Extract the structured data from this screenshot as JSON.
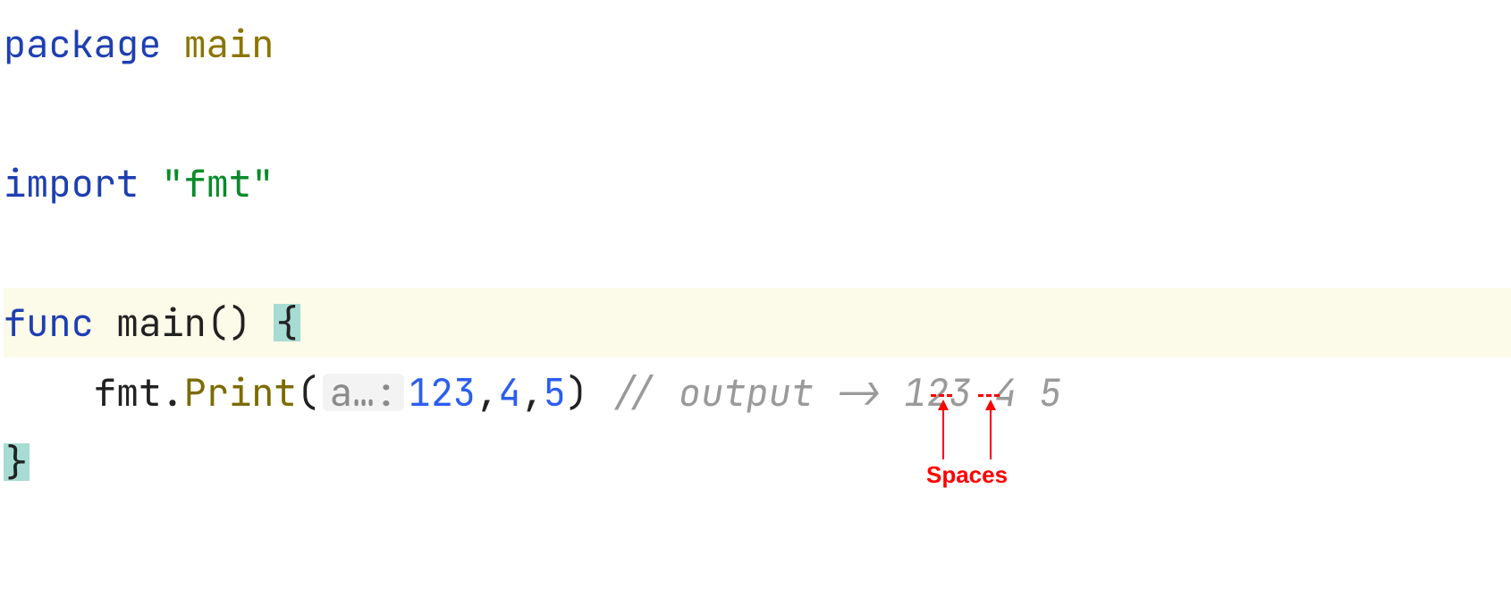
{
  "code": {
    "line1": {
      "keyword": "package",
      "name": "main"
    },
    "line3": {
      "keyword": "import",
      "pkg": "\"fmt\""
    },
    "line5": {
      "keyword": "func",
      "name": "main",
      "parens": "()",
      "brace": "{"
    },
    "line6": {
      "indent": "    ",
      "receiver": "fmt",
      "dot": ".",
      "call": "Print",
      "open": "(",
      "hint": "a…:",
      "arg1": "123",
      "comma1": ",",
      "arg2": "4",
      "comma2": ",",
      "arg3": "5",
      "close": ")",
      "space": " ",
      "comment": "// output -> 123 4 5"
    },
    "line7": {
      "brace": "}"
    }
  },
  "annotation": {
    "label": "Spaces"
  }
}
